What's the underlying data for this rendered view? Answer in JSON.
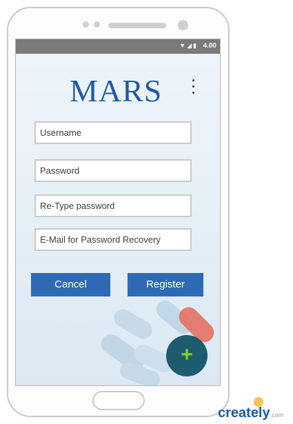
{
  "app": {
    "title": "MARS"
  },
  "status_bar": {
    "time": "4.00",
    "icons": [
      "wifi-icon",
      "signal-icon",
      "battery-icon"
    ]
  },
  "form": {
    "username_placeholder": "Username",
    "password_placeholder": "Password",
    "retype_placeholder": "Re-Type password",
    "email_placeholder": "E-Mail for Password Recovery"
  },
  "buttons": {
    "cancel": "Cancel",
    "register": "Register",
    "fab": "+"
  },
  "watermark": {
    "brand": "creately",
    "suffix": ".com"
  },
  "colors": {
    "primary": "#2e6ab3",
    "title": "#1d5aa8",
    "fab": "#1d5b6f",
    "fab_plus": "#7fd320"
  }
}
